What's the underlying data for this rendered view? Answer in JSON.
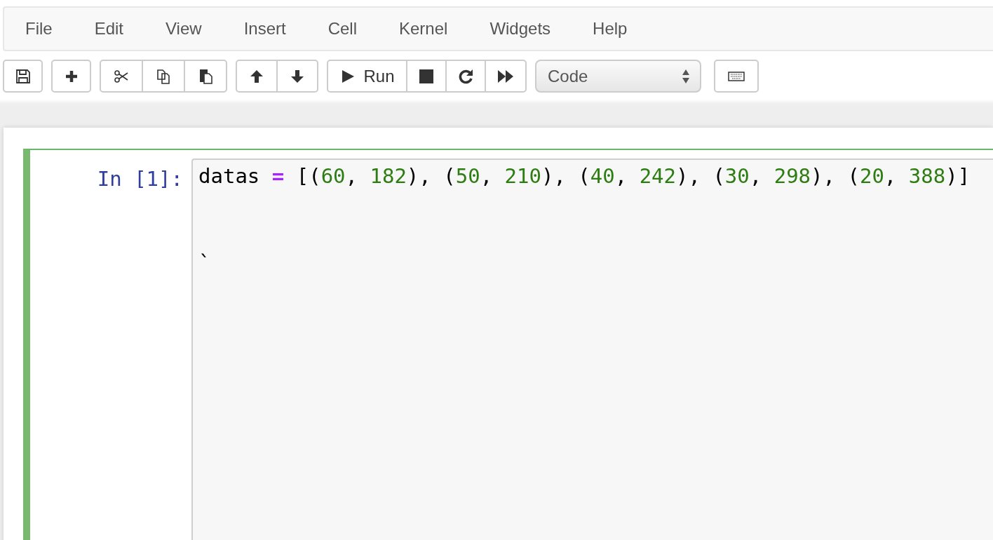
{
  "menu_bar": {
    "items": [
      {
        "label": "File"
      },
      {
        "label": "Edit"
      },
      {
        "label": "View"
      },
      {
        "label": "Insert"
      },
      {
        "label": "Cell"
      },
      {
        "label": "Kernel"
      },
      {
        "label": "Widgets"
      },
      {
        "label": "Help"
      }
    ]
  },
  "toolbar": {
    "run_label": "Run",
    "cell_type": "Code"
  },
  "cell": {
    "selected": true,
    "prompt": "In [1]:",
    "lines": [
      {
        "tokens": [
          {
            "text": "datas ",
            "kind": "name"
          },
          {
            "text": "=",
            "kind": "operator"
          },
          {
            "text": " [(",
            "kind": "name"
          },
          {
            "text": "60",
            "kind": "number"
          },
          {
            "text": ", ",
            "kind": "name"
          },
          {
            "text": "182",
            "kind": "number"
          },
          {
            "text": "), (",
            "kind": "name"
          },
          {
            "text": "50",
            "kind": "number"
          },
          {
            "text": ", ",
            "kind": "name"
          },
          {
            "text": "210",
            "kind": "number"
          },
          {
            "text": "), (",
            "kind": "name"
          },
          {
            "text": "40",
            "kind": "number"
          },
          {
            "text": ", ",
            "kind": "name"
          },
          {
            "text": "242",
            "kind": "number"
          },
          {
            "text": "), (",
            "kind": "name"
          },
          {
            "text": "30",
            "kind": "number"
          },
          {
            "text": ", ",
            "kind": "name"
          },
          {
            "text": "298",
            "kind": "number"
          },
          {
            "text": "), (",
            "kind": "name"
          },
          {
            "text": "20",
            "kind": "number"
          },
          {
            "text": ", ",
            "kind": "name"
          },
          {
            "text": "388",
            "kind": "number"
          },
          {
            "text": ")]",
            "kind": "name"
          }
        ]
      },
      {
        "tokens": [
          {
            "text": "`",
            "kind": "name"
          }
        ]
      }
    ]
  }
}
